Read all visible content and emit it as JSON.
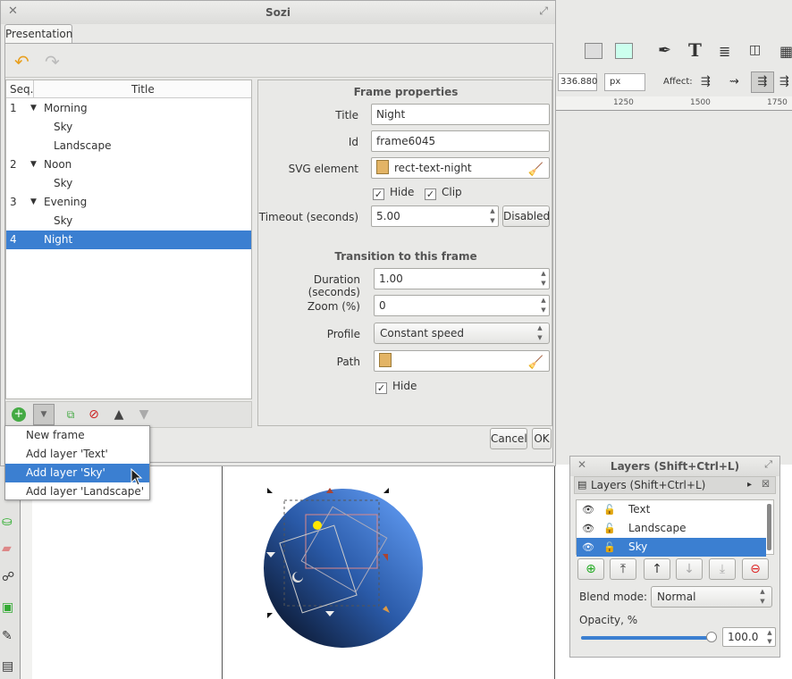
{
  "sozi": {
    "title": "Sozi",
    "tab": "Presentation",
    "tree": {
      "col_seq": "Seq.",
      "col_title": "Title",
      "rows": [
        {
          "seq": "1",
          "label": "Morning",
          "parent": true
        },
        {
          "seq": "",
          "label": "Sky",
          "parent": false
        },
        {
          "seq": "",
          "label": "Landscape",
          "parent": false
        },
        {
          "seq": "2",
          "label": "Noon",
          "parent": true
        },
        {
          "seq": "",
          "label": "Sky",
          "parent": false
        },
        {
          "seq": "3",
          "label": "Evening",
          "parent": true
        },
        {
          "seq": "",
          "label": "Sky",
          "parent": false
        },
        {
          "seq": "4",
          "label": "Night",
          "parent": false,
          "selected": true
        }
      ]
    },
    "frame_props": {
      "heading": "Frame properties",
      "title_label": "Title",
      "title_value": "Night",
      "id_label": "Id",
      "id_value": "frame6045",
      "svg_label": "SVG element",
      "svg_value": "rect-text-night",
      "hide_label": "Hide",
      "clip_label": "Clip",
      "timeout_label": "Timeout (seconds)",
      "timeout_value": "5.00",
      "disabled_label": "Disabled"
    },
    "transition": {
      "heading": "Transition to this frame",
      "duration_label": "Duration (seconds)",
      "duration_value": "1.00",
      "zoom_label": "Zoom (%)",
      "zoom_value": "0",
      "profile_label": "Profile",
      "profile_value": "Constant speed",
      "path_label": "Path",
      "hide_label": "Hide"
    },
    "cancel": "Cancel",
    "ok": "OK"
  },
  "popup": {
    "items": [
      "New frame",
      "Add layer 'Text'",
      "Add layer 'Sky'",
      "Add layer 'Landscape'"
    ],
    "selected_index": 2
  },
  "inkscape": {
    "toolbar_value": "336.880",
    "unit": "px",
    "affect": "Affect:",
    "ruler": [
      "1250",
      "1500",
      "1750"
    ]
  },
  "layers": {
    "title": "Layers (Shift+Ctrl+L)",
    "header": "Layers (Shift+Ctrl+L)",
    "items": [
      "Text",
      "Landscape",
      "Sky"
    ],
    "selected_index": 2,
    "blend_label": "Blend mode:",
    "blend_value": "Normal",
    "opacity_label": "Opacity, %",
    "opacity_value": "100.0",
    "opacity_level": 1.0
  },
  "colors": {
    "selection": "#3b7fd1"
  }
}
